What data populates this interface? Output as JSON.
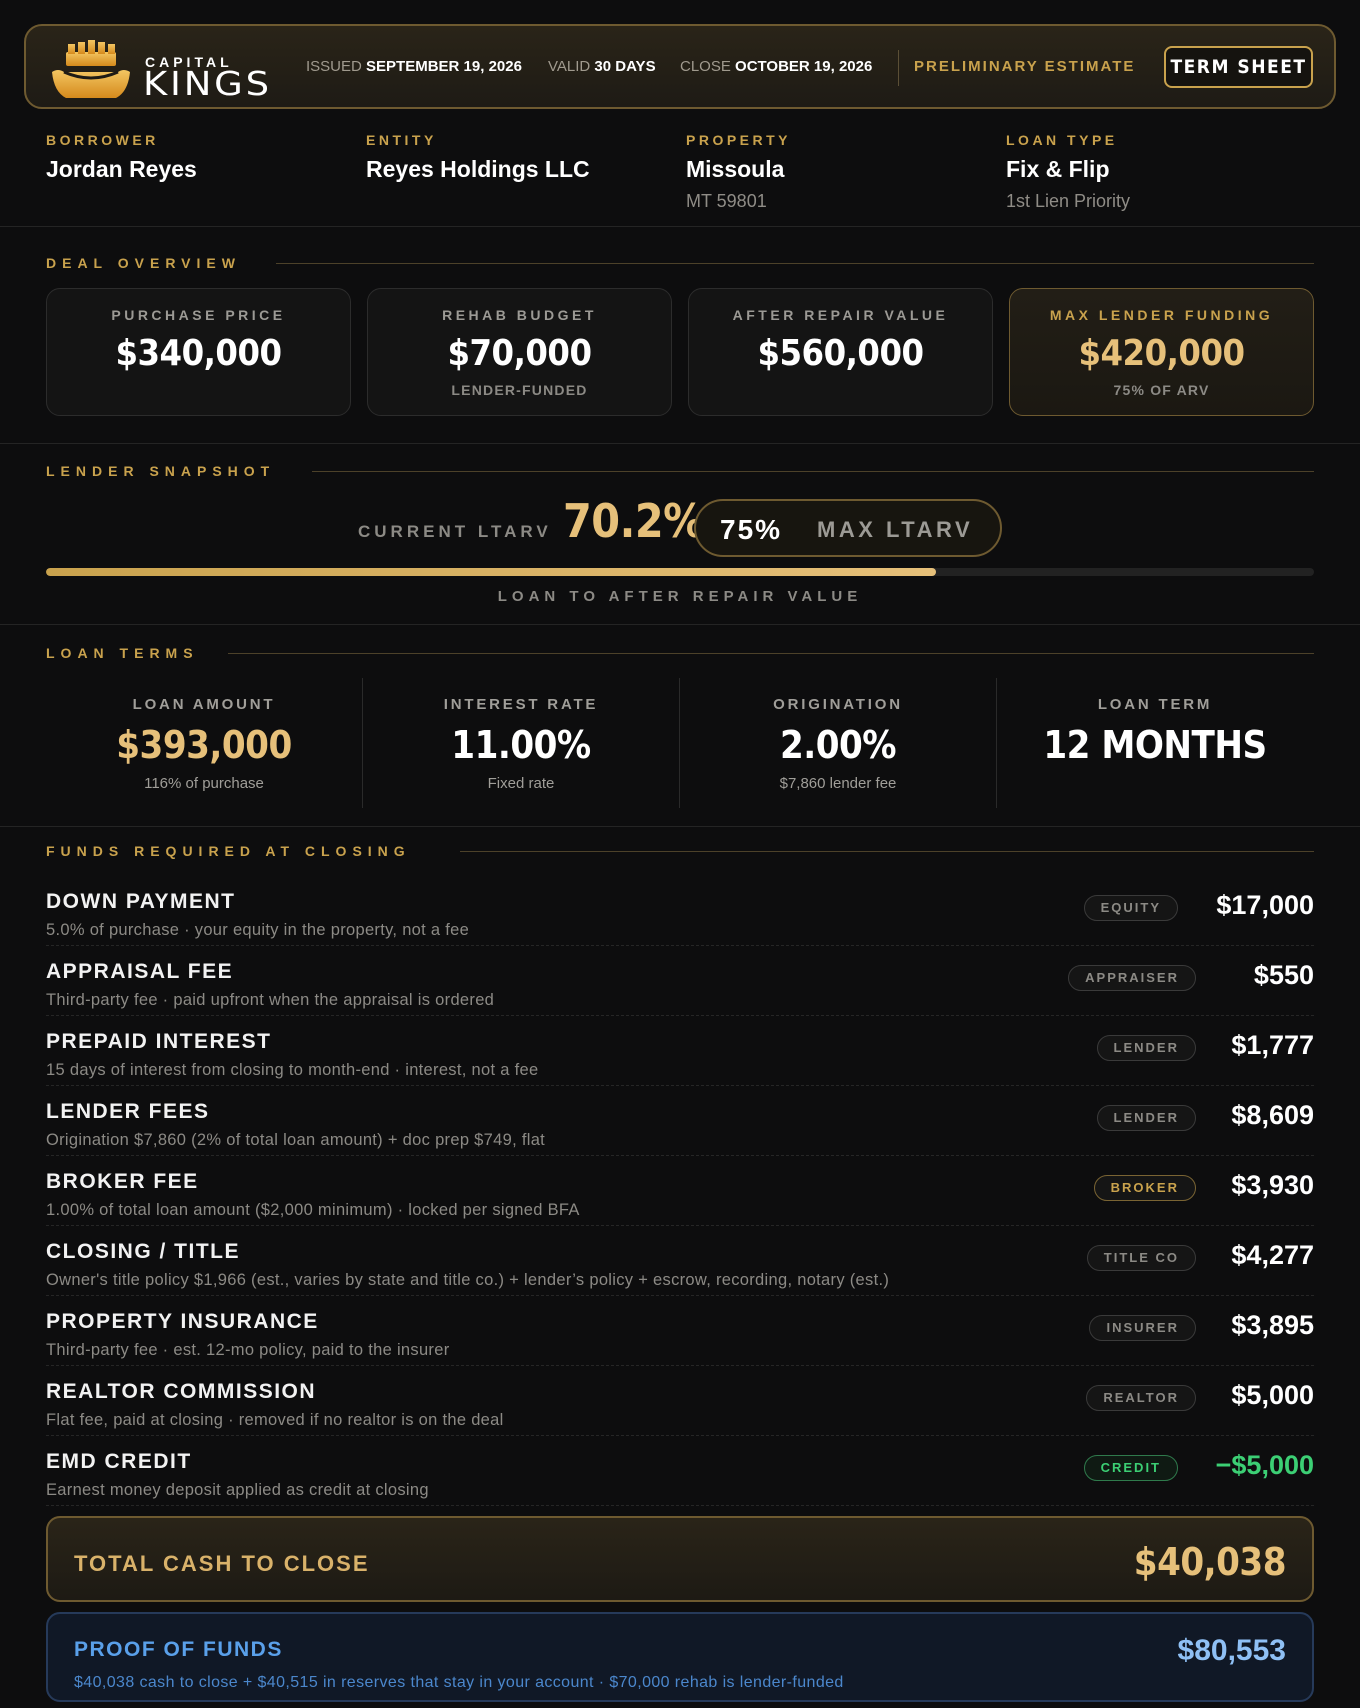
{
  "brand": {
    "name_top": "CAPITAL",
    "name_main": "KINGS",
    "icon": "crown-icon",
    "accent_color": "#c9a24d"
  },
  "header": {
    "issued_label": "ISSUED",
    "issued_value": "SEPTEMBER 19, 2026",
    "valid_label": "VALID",
    "valid_value": "30 DAYS",
    "close_label": "CLOSE",
    "close_value": "OCTOBER 19, 2026",
    "status": "PRELIMINARY ESTIMATE",
    "doc_type": "TERM SHEET"
  },
  "parties": {
    "borrower": {
      "label": "BORROWER",
      "value": "Jordan Reyes"
    },
    "entity": {
      "label": "ENTITY",
      "value": "Reyes Holdings LLC"
    },
    "property": {
      "label": "PROPERTY",
      "value": "Missoula",
      "sub": "MT 59801"
    },
    "loan_type": {
      "label": "LOAN TYPE",
      "value": "Fix & Flip",
      "sub": "1st Lien Priority"
    }
  },
  "deal_overview": {
    "title": "DEAL OVERVIEW",
    "cards": [
      {
        "label": "PURCHASE PRICE",
        "value": "$340,000",
        "sub": ""
      },
      {
        "label": "REHAB BUDGET",
        "value": "$70,000",
        "sub": "LENDER-FUNDED"
      },
      {
        "label": "AFTER REPAIR VALUE",
        "value": "$560,000",
        "sub": ""
      },
      {
        "label": "MAX LENDER FUNDING",
        "value": "$420,000",
        "sub": "75% OF ARV"
      }
    ]
  },
  "lender_snapshot": {
    "title": "LENDER SNAPSHOT",
    "current_label": "CURRENT LTARV",
    "current_value": "70.2%",
    "max_value": "75%",
    "max_label": "MAX LTARV",
    "progress_percent": 70.2,
    "caption": "LOAN TO AFTER REPAIR VALUE"
  },
  "loan_terms": {
    "title": "LOAN TERMS",
    "items": [
      {
        "label": "LOAN AMOUNT",
        "value": "$393,000",
        "sub": "116% of purchase"
      },
      {
        "label": "INTEREST RATE",
        "value": "11.00%",
        "sub": "Fixed rate"
      },
      {
        "label": "ORIGINATION",
        "value": "2.00%",
        "sub": "$7,860 lender fee"
      },
      {
        "label": "LOAN TERM",
        "value": "12 MONTHS",
        "sub": ""
      }
    ]
  },
  "funds": {
    "title": "FUNDS REQUIRED AT CLOSING",
    "rows": [
      {
        "title": "DOWN PAYMENT",
        "desc": "5.0% of purchase · your equity in the property, not a fee",
        "badge": "EQUITY",
        "amount": "$17,000"
      },
      {
        "title": "APPRAISAL FEE",
        "desc": "Third-party fee · paid upfront when the appraisal is ordered",
        "badge": "APPRAISER",
        "amount": "$550"
      },
      {
        "title": "PREPAID INTEREST",
        "desc": "15 days of interest from closing to month-end · interest, not a fee",
        "badge": "LENDER",
        "amount": "$1,777"
      },
      {
        "title": "LENDER FEES",
        "desc": "Origination $7,860 (2% of total loan amount) + doc prep $749, flat",
        "badge": "LENDER",
        "amount": "$8,609"
      },
      {
        "title": "BROKER FEE",
        "desc": "1.00% of total loan amount ($2,000 minimum) · locked per signed BFA",
        "badge": "BROKER",
        "amount": "$3,930"
      },
      {
        "title": "CLOSING / TITLE",
        "desc": "Owner's title policy $1,966 (est., varies by state and title co.) + lender’s policy + escrow, recording, notary (est.)",
        "badge": "TITLE CO",
        "amount": "$4,277"
      },
      {
        "title": "PROPERTY INSURANCE",
        "desc": "Third-party fee · est. 12-mo policy, paid to the insurer",
        "badge": "INSURER",
        "amount": "$3,895"
      },
      {
        "title": "REALTOR COMMISSION",
        "desc": "Flat fee, paid at closing · removed if no realtor is on the deal",
        "badge": "REALTOR",
        "amount": "$5,000"
      },
      {
        "title": "EMD CREDIT",
        "desc": "Earnest money deposit applied as credit at closing",
        "badge": "CREDIT",
        "amount": "−$5,000"
      }
    ],
    "total_label": "TOTAL CASH TO CLOSE",
    "total_value": "$40,038"
  },
  "proof_of_funds": {
    "label": "PROOF OF FUNDS",
    "desc": "$40,038 cash to close + $40,515 in reserves that stay in your account · $70,000 rehab is lender-funded",
    "value": "$80,553"
  }
}
